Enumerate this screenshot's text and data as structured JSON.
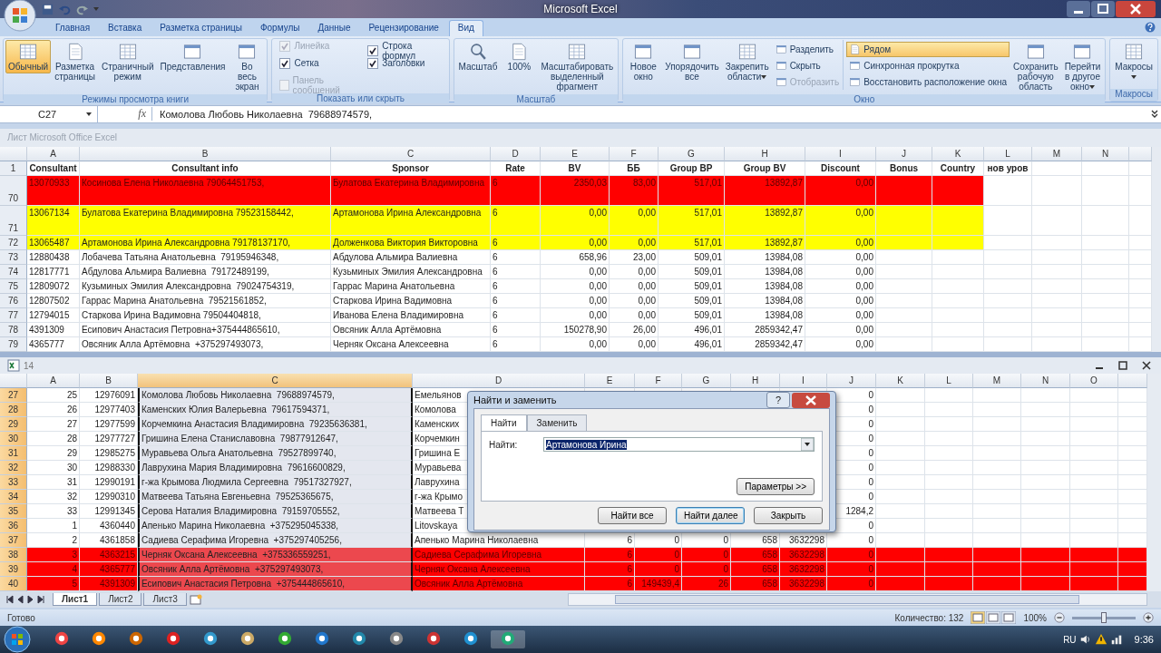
{
  "title_bar": {
    "title": "Microsoft Excel"
  },
  "ribbon": {
    "tabs": [
      {
        "label": "Главная",
        "selected": false
      },
      {
        "label": "Вставка",
        "selected": false
      },
      {
        "label": "Разметка страницы",
        "selected": false
      },
      {
        "label": "Формулы",
        "selected": false
      },
      {
        "label": "Данные",
        "selected": false
      },
      {
        "label": "Рецензирование",
        "selected": false
      },
      {
        "label": "Вид",
        "selected": true
      }
    ],
    "view_group": {
      "label": "Режимы просмотра книги",
      "buttons": [
        {
          "label": "Обычный",
          "selected": true
        },
        {
          "label": "Разметка страницы",
          "selected": false
        },
        {
          "label": "Страничный режим",
          "selected": false
        },
        {
          "label": "Представления",
          "selected": false
        },
        {
          "label": "Во весь экран",
          "selected": false
        }
      ]
    },
    "show_group": {
      "label": "Показать или скрыть",
      "checkboxes": [
        {
          "label": "Линейка",
          "checked": true,
          "disabled": true
        },
        {
          "label": "Сетка",
          "checked": true,
          "disabled": false
        },
        {
          "label": "Панель сообщений",
          "checked": false,
          "disabled": true
        },
        {
          "label": "Строка формул",
          "checked": true,
          "disabled": false
        },
        {
          "label": "Заголовки",
          "checked": true,
          "disabled": false
        }
      ]
    },
    "zoom_group": {
      "label": "Масштаб",
      "buttons": [
        {
          "label": "Масштаб"
        },
        {
          "label": "100%"
        },
        {
          "label": "Масштабировать выделенный фрагмент"
        }
      ]
    },
    "window_group": {
      "label": "Окно",
      "large_buttons": [
        {
          "label": "Новое окно",
          "dropdown": false
        },
        {
          "label": "Упорядочить все",
          "dropdown": false
        },
        {
          "label": "Закрепить области",
          "dropdown": true
        }
      ],
      "small_buttons": [
        {
          "label": "Разделить",
          "disabled": false,
          "selected": false
        },
        {
          "label": "Скрыть",
          "disabled": false,
          "selected": false
        },
        {
          "label": "Отобразить",
          "disabled": true,
          "selected": false
        },
        {
          "label": "Рядом",
          "disabled": false,
          "selected": true
        },
        {
          "label": "Синхронная прокрутка",
          "disabled": false,
          "selected": false
        },
        {
          "label": "Восстановить расположение окна",
          "disabled": false,
          "selected": false
        }
      ],
      "extra_buttons": [
        {
          "label": "Сохранить рабочую область",
          "dropdown": false
        },
        {
          "label": "Перейти в другое окно",
          "dropdown": true
        }
      ]
    },
    "macro_group": {
      "label": "Макросы",
      "buttons": [
        {
          "label": "Макросы",
          "dropdown": true
        }
      ]
    }
  },
  "formula_bar": {
    "name_box": "C27",
    "function_button": "fx",
    "formula": "Комолова Любовь Николаевна  79688974579,"
  },
  "top_window": {
    "title": "Лист Microsoft Office Excel",
    "columns": [
      "A",
      "B",
      "C",
      "D",
      "E",
      "F",
      "G",
      "H",
      "I",
      "J",
      "K",
      "L",
      "M",
      "N"
    ],
    "header_row": {
      "num": "1",
      "cells": {
        "A": "Consultant",
        "B": "Consultant info",
        "C": "Sponsor",
        "D": "Rate",
        "E": "BV",
        "F": "ББ",
        "G": "Group BP",
        "H": "Group BV",
        "I": "Discount",
        "J": "Bonus",
        "K": "Country",
        "L": "нов уров"
      }
    },
    "rows": [
      {
        "num": "70",
        "tall": true,
        "color": "#ff0000",
        "cells": {
          "A": "13070933",
          "B": "Косинова Елена Николаевна 79064451753,",
          "C": "Булатова Екатерина Владимировна",
          "D": "6",
          "E": "2350,03",
          "F": "83,00",
          "G": "517,01",
          "H": "13892,87",
          "I": "0,00"
        }
      },
      {
        "num": "71",
        "tall": true,
        "color": "#ffff00",
        "cells": {
          "A": "13067134",
          "B": "Булатова Екатерина Владимировна 79523158442,",
          "C": "Артамонова Ирина Александровна",
          "D": "6",
          "E": "0,00",
          "F": "0,00",
          "G": "517,01",
          "H": "13892,87",
          "I": "0,00"
        }
      },
      {
        "num": "72",
        "tall": false,
        "color": "#ffff00",
        "cells": {
          "A": "13065487",
          "B": "Артамонова Ирина Александровна 79178137170,",
          "C": "Долженкова Виктория Викторовна",
          "D": "6",
          "E": "0,00",
          "F": "0,00",
          "G": "517,01",
          "H": "13892,87",
          "I": "0,00"
        }
      },
      {
        "num": "73",
        "tall": false,
        "cells": {
          "A": "12880438",
          "B": "Лобачева Татьяна Анатольевна  79195946348,",
          "C": "Абдулова Альмира Валиевна",
          "D": "6",
          "E": "658,96",
          "F": "23,00",
          "G": "509,01",
          "H": "13984,08",
          "I": "0,00"
        }
      },
      {
        "num": "74",
        "tall": false,
        "cells": {
          "A": "12817771",
          "B": "Абдулова Альмира Валиевна  79172489199,",
          "C": "Кузьминых Эмилия Александровна",
          "D": "6",
          "E": "0,00",
          "F": "0,00",
          "G": "509,01",
          "H": "13984,08",
          "I": "0,00"
        }
      },
      {
        "num": "75",
        "tall": false,
        "cells": {
          "A": "12809072",
          "B": "Кузьминых Эмилия Александровна  79024754319,",
          "C": "Гаррас Марина Анатольевна",
          "D": "6",
          "E": "0,00",
          "F": "0,00",
          "G": "509,01",
          "H": "13984,08",
          "I": "0,00"
        }
      },
      {
        "num": "76",
        "tall": false,
        "cells": {
          "A": "12807502",
          "B": "Гаррас Марина Анатольевна  79521561852,",
          "C": "Старкова Ирина Вадимовна",
          "D": "6",
          "E": "0,00",
          "F": "0,00",
          "G": "509,01",
          "H": "13984,08",
          "I": "0,00"
        }
      },
      {
        "num": "77",
        "tall": false,
        "cells": {
          "A": "12794015",
          "B": "Старкова Ирина Вадимовна 79504404818,",
          "C": "Иванова Елена Владимировна",
          "D": "6",
          "E": "0,00",
          "F": "0,00",
          "G": "509,01",
          "H": "13984,08",
          "I": "0,00"
        }
      },
      {
        "num": "78",
        "tall": false,
        "cells": {
          "A": "4391309",
          "B": "Есипович Анастасия Петровна+375444865610,",
          "C": "Овсяник Алла Артёмовна",
          "D": "6",
          "E": "150278,90",
          "F": "26,00",
          "G": "496,01",
          "H": "2859342,47",
          "I": "0,00"
        }
      },
      {
        "num": "79",
        "tall": false,
        "cells": {
          "A": "4365777",
          "B": "Овсяник Алла Артёмовна  +375297493073,",
          "C": "Черняк Оксана Алексеевна",
          "D": "6",
          "E": "0,00",
          "F": "0,00",
          "G": "496,01",
          "H": "2859342,47",
          "I": "0,00"
        }
      }
    ]
  },
  "bottom_window": {
    "title": "14",
    "columns": [
      {
        "label": "A",
        "selected": false
      },
      {
        "label": "B",
        "selected": false
      },
      {
        "label": "C",
        "selected": true
      },
      {
        "label": "D",
        "selected": false
      },
      {
        "label": "E",
        "selected": false
      },
      {
        "label": "F",
        "selected": false
      },
      {
        "label": "G",
        "selected": false
      },
      {
        "label": "H",
        "selected": false
      },
      {
        "label": "I",
        "selected": false
      },
      {
        "label": "J",
        "selected": false
      },
      {
        "label": "K",
        "selected": false
      },
      {
        "label": "L",
        "selected": false
      },
      {
        "label": "M",
        "selected": false
      },
      {
        "label": "N",
        "selected": false
      },
      {
        "label": "O",
        "selected": false
      }
    ],
    "rows": [
      {
        "num": "27",
        "selected": true,
        "cells": {
          "A": "25",
          "B": "12976091",
          "C": "Комолова Любовь Николаевна  79688974579,",
          "D": "Емельянов",
          "J": "0"
        }
      },
      {
        "num": "28",
        "selected": true,
        "cells": {
          "A": "26",
          "B": "12977403",
          "C": "Каменских Юлия Валерьевна  79617594371,",
          "D": "Комолова",
          "J": "0"
        }
      },
      {
        "num": "29",
        "selected": true,
        "cells": {
          "A": "27",
          "B": "12977599",
          "C": "Корчемкина Анастасия Владимировна  79235636381,",
          "D": "Каменских",
          "J": "0"
        }
      },
      {
        "num": "30",
        "selected": true,
        "cells": {
          "A": "28",
          "B": "12977727",
          "C": "Гришина Елена Станиславовна  79877912647,",
          "D": "Корчемкин",
          "J": "0"
        }
      },
      {
        "num": "31",
        "selected": true,
        "cells": {
          "A": "29",
          "B": "12985275",
          "C": "Муравьева Ольга Анатольевна  79527899740,",
          "D": "Гришина Е",
          "J": "0"
        }
      },
      {
        "num": "32",
        "selected": true,
        "cells": {
          "A": "30",
          "B": "12988330",
          "C": "Лаврухина Мария Владимировна  79616600829,",
          "D": "Муравьева",
          "J": "0"
        }
      },
      {
        "num": "33",
        "selected": true,
        "cells": {
          "A": "31",
          "B": "12990191",
          "C": "г-жа Крымова Людмила Сергеевна  79517327927,",
          "D": "Лаврухина",
          "J": "0"
        }
      },
      {
        "num": "34",
        "selected": true,
        "cells": {
          "A": "32",
          "B": "12990310",
          "C": "Матвеева Татьяна Евгеньевна  79525365675,",
          "D": "г-жа Крымо",
          "J": "0"
        }
      },
      {
        "num": "35",
        "selected": true,
        "cells": {
          "A": "33",
          "B": "12991345",
          "C": "Серова Наталия Владимировна  79159705552,",
          "D": "Матвеева Т",
          "J": "1284,2"
        }
      },
      {
        "num": "36",
        "selected": true,
        "cells": {
          "A": "1",
          "B": "4360440",
          "C": "Апенько Марина Николаевна  +375295045338,",
          "D": "Litovskaya",
          "J": "0"
        }
      },
      {
        "num": "37",
        "selected": true,
        "cells": {
          "A": "2",
          "B": "4361858",
          "C": "Садиева Серафима Игоревна  +375297405256,",
          "D": "Апенько Марина Николаевна",
          "E": "6",
          "F": "0",
          "G": "0",
          "H": "658",
          "I": "3632298",
          "J": "0"
        }
      },
      {
        "num": "38",
        "selected": true,
        "color": "#ff0000",
        "cells": {
          "A": "3",
          "B": "4363215",
          "C": "Черняк Оксана Алексеевна  +375336559251,",
          "D": "Садиева Серафима Игоревна",
          "E": "6",
          "F": "0",
          "G": "0",
          "H": "658",
          "I": "3632298",
          "J": "0"
        }
      },
      {
        "num": "39",
        "selected": true,
        "color": "#ff0000",
        "cells": {
          "A": "4",
          "B": "4365777",
          "C": "Овсяник Алла Артёмовна  +375297493073,",
          "D": "Черняк Оксана Алексеевна",
          "E": "6",
          "F": "0",
          "G": "0",
          "H": "658",
          "I": "3632298",
          "J": "0"
        }
      },
      {
        "num": "40",
        "selected": true,
        "color": "#ff0000",
        "cells": {
          "A": "5",
          "B": "4391309",
          "C": "Есипович Анастасия Петровна  +375444865610,",
          "D": "Овсяник Алла Артёмовна",
          "E": "6",
          "F": "149439,4",
          "G": "26",
          "H": "658",
          "I": "3632298",
          "J": "0"
        }
      }
    ],
    "sheet_tabs": [
      {
        "label": "Лист1",
        "selected": true
      },
      {
        "label": "Лист2",
        "selected": false
      },
      {
        "label": "Лист3",
        "selected": false
      }
    ]
  },
  "dialog": {
    "title": "Найти и заменить",
    "help_button": "?",
    "tabs": [
      {
        "label": "Найти",
        "selected": true
      },
      {
        "label": "Заменить",
        "selected": false
      }
    ],
    "find_label": "Найти:",
    "find_value": "Артамонова Ирина",
    "value_selected": true,
    "options_button": "Параметры >>",
    "buttons": [
      "Найти все",
      "Найти далее",
      "Закрыть"
    ]
  },
  "status_bar": {
    "status": "Готово",
    "count": "Количество: 132",
    "view_buttons": [
      {
        "selected": true
      },
      {
        "selected": false
      },
      {
        "selected": false
      }
    ],
    "zoom": "100%",
    "zoom_slider": {
      "level": 0.5
    }
  },
  "taskbar": {
    "language": "RU",
    "clock": "9:36"
  }
}
